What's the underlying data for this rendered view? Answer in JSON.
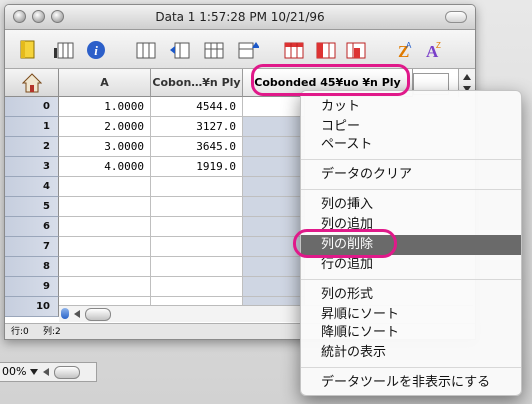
{
  "window": {
    "title": "Data 1 1:57:28 PM 10/21/96"
  },
  "columns": [
    {
      "label": "A"
    },
    {
      "label": "Cobon…¥n Ply"
    },
    {
      "label": "Cobonded 45¥uo ¥n Ply"
    }
  ],
  "rows": [
    {
      "index": "0",
      "a": "1.0000",
      "b": "4544.0"
    },
    {
      "index": "1",
      "a": "2.0000",
      "b": "3127.0"
    },
    {
      "index": "2",
      "a": "3.0000",
      "b": "3645.0"
    },
    {
      "index": "3",
      "a": "4.0000",
      "b": "1919.0"
    },
    {
      "index": "4",
      "a": "",
      "b": ""
    },
    {
      "index": "5",
      "a": "",
      "b": ""
    },
    {
      "index": "6",
      "a": "",
      "b": ""
    },
    {
      "index": "7",
      "a": "",
      "b": ""
    },
    {
      "index": "8",
      "a": "",
      "b": ""
    },
    {
      "index": "9",
      "a": "",
      "b": ""
    },
    {
      "index": "10",
      "a": "",
      "b": ""
    }
  ],
  "status": {
    "row_label": "行:0",
    "col_label": "列:2"
  },
  "zoom": {
    "value": "00%"
  },
  "context_menu": {
    "items": [
      {
        "label": "カット"
      },
      {
        "label": "コピー"
      },
      {
        "label": "ペースト"
      },
      {
        "label": "データのクリア"
      },
      {
        "label": "列の挿入"
      },
      {
        "label": "列の追加"
      },
      {
        "label": "列の削除",
        "highlighted": true
      },
      {
        "label": "行の追加"
      },
      {
        "label": "列の形式"
      },
      {
        "label": "昇順にソート"
      },
      {
        "label": "降順にソート"
      },
      {
        "label": "統計の表示"
      },
      {
        "label": "データツールを非表示にする"
      }
    ]
  },
  "colors": {
    "annotation": "#e0198a",
    "selection": "#cfd6e3",
    "menu_highlight": "#6a6a6a"
  }
}
